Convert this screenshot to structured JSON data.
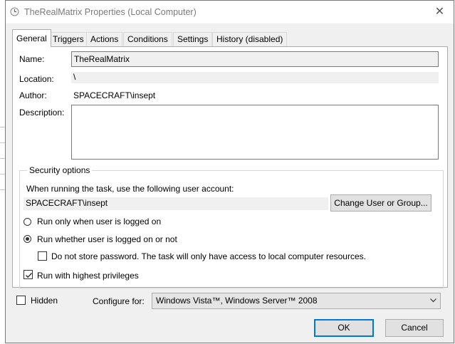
{
  "window": {
    "title": "TheRealMatrix Properties (Local Computer)",
    "close_glyph": "✕"
  },
  "tabs": [
    {
      "label": "General",
      "active": true
    },
    {
      "label": "Triggers"
    },
    {
      "label": "Actions"
    },
    {
      "label": "Conditions"
    },
    {
      "label": "Settings"
    },
    {
      "label": "History (disabled)"
    }
  ],
  "general": {
    "name_label": "Name:",
    "name_value": "TheRealMatrix",
    "location_label": "Location:",
    "location_value": "\\",
    "author_label": "Author:",
    "author_value": "SPACECRAFT\\insept",
    "description_label": "Description:",
    "description_value": ""
  },
  "security": {
    "group_title": "Security options",
    "account_prompt": "When running the task, use the following user account:",
    "account_value": "SPACECRAFT\\insept",
    "change_user_button": "Change User or Group...",
    "radio_logged_on": {
      "label": "Run only when user is logged on",
      "selected": false
    },
    "radio_whether": {
      "label": "Run whether user is logged on or not",
      "selected": true
    },
    "do_not_store": {
      "label": "Do not store password.  The task will only have access to local computer resources.",
      "checked": false
    },
    "highest_privileges": {
      "label": "Run with highest privileges",
      "checked": true
    }
  },
  "footer": {
    "hidden": {
      "label": "Hidden",
      "checked": false
    },
    "configure_label": "Configure for:",
    "configure_value": "Windows Vista™, Windows Server™ 2008"
  },
  "buttons": {
    "ok": "OK",
    "cancel": "Cancel"
  },
  "colors": {
    "accent": "#0078d7",
    "title_text": "#7a7a7a"
  },
  "icons": {
    "title": "task-scheduler-clock-icon",
    "close": "close-icon",
    "dropdown": "chevron-down-icon"
  }
}
